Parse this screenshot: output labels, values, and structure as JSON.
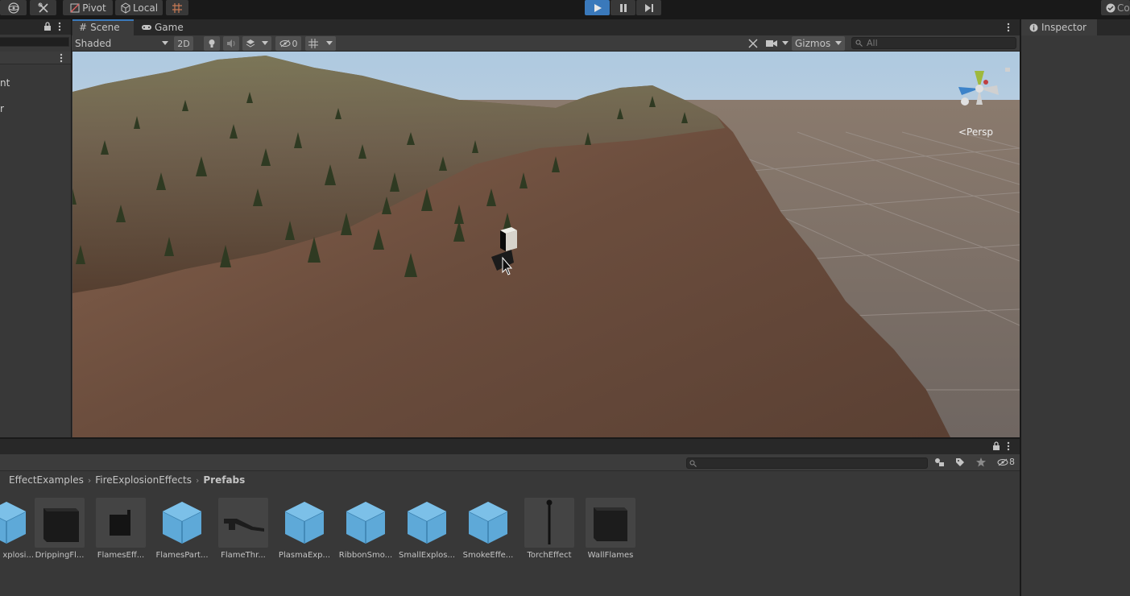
{
  "toolbar": {
    "pivot_label": "Pivot",
    "local_label": "Local",
    "collab_label": "Co"
  },
  "hierarchy": {
    "items": [
      "nt",
      "r"
    ]
  },
  "scene": {
    "tabs": [
      {
        "label": "Scene"
      },
      {
        "label": "Game"
      }
    ],
    "shading_mode": "Shaded",
    "mode_2d_label": "2D",
    "hidden_count": "0",
    "gizmos_label": "Gizmos",
    "search_placeholder": "All",
    "persp_label": "<Persp"
  },
  "inspector": {
    "tab_label": "Inspector"
  },
  "project": {
    "hidden_count": "8",
    "breadcrumb": [
      "EffectExamples",
      "FireExplosionEffects",
      "Prefabs"
    ],
    "assets": [
      {
        "label": "xplosi...",
        "icon": "prefab-cube-icon"
      },
      {
        "label": "DrippingFl...",
        "icon": "black-cube-icon"
      },
      {
        "label": "FlamesEff...",
        "icon": "black-box-icon"
      },
      {
        "label": "FlamesPart...",
        "icon": "prefab-cube-icon"
      },
      {
        "label": "FlameThr...",
        "icon": "flamethrower-icon"
      },
      {
        "label": "PlasmaExp...",
        "icon": "prefab-cube-icon"
      },
      {
        "label": "RibbonSmo...",
        "icon": "prefab-cube-icon"
      },
      {
        "label": "SmallExplos...",
        "icon": "prefab-cube-icon"
      },
      {
        "label": "SmokeEffe...",
        "icon": "prefab-cube-icon"
      },
      {
        "label": "TorchEffect",
        "icon": "torch-icon"
      },
      {
        "label": "WallFlames",
        "icon": "black-cube-icon"
      }
    ]
  },
  "colors": {
    "accent": "#3a79bb",
    "prefab_blue": "#5ea9d8",
    "panel": "#383838"
  }
}
